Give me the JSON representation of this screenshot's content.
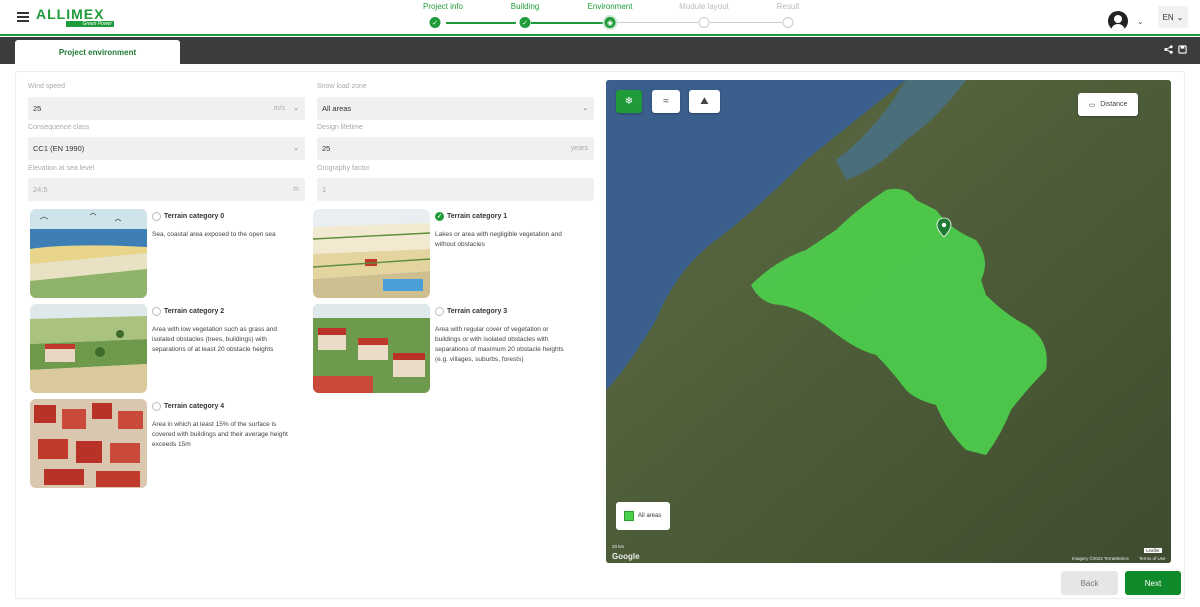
{
  "brand": {
    "name": "ALLIMEX",
    "tagline": "Green Power"
  },
  "language": "EN",
  "steps": [
    {
      "label": "Project info",
      "state": "done"
    },
    {
      "label": "Building",
      "state": "done"
    },
    {
      "label": "Environment",
      "state": "current"
    },
    {
      "label": "Module layout",
      "state": "todo"
    },
    {
      "label": "Result",
      "state": "todo"
    }
  ],
  "tab": {
    "label": "Project environment"
  },
  "fields": {
    "wind_speed": {
      "label": "Wind speed",
      "value": "25",
      "unit": "m/s"
    },
    "snow_load_zone": {
      "label": "Snow load zone",
      "value": "All areas"
    },
    "consequence_class": {
      "label": "Consequence class",
      "value": "CC1 (EN 1990)"
    },
    "design_lifetime": {
      "label": "Design lifetime",
      "value": "25",
      "unit": "years"
    },
    "elevation": {
      "label": "Elevation at sea level",
      "value": "24.5",
      "unit": "m"
    },
    "orography": {
      "label": "Orography factor",
      "value": "1"
    }
  },
  "terrain": [
    {
      "title": "Terrain category 0",
      "desc": "Sea, coastal area exposed to the open sea",
      "checked": false
    },
    {
      "title": "Terrain category 1",
      "desc": "Lakes or area with negligible vegetation and without obstacles",
      "checked": true
    },
    {
      "title": "Terrain category 2",
      "desc": "Area with low vegetation such as grass and isolated obstacles (trees, buildings) with separations of at least 20 obstacle heights",
      "checked": false
    },
    {
      "title": "Terrain category 3",
      "desc": "Area with regular cover of vegetation or buildings or with isolated obstacles with separations of maximum 20 obstacle heights (e.g. villages, suburbs, forests)",
      "checked": false
    },
    {
      "title": "Terrain category 4",
      "desc": "Area in which at least 15% of the surface is covered with buildings and their average height exceeds 15m",
      "checked": false
    }
  ],
  "map": {
    "distance_label": "Distance",
    "legend_label": "All areas",
    "legend_color": "#4cd14c",
    "scale": "20 km",
    "google": "Google",
    "leaflet": "Leaflet",
    "imagery": "Imagery ©2022 TerraMetrics",
    "terms": "Terms of Use"
  },
  "buttons": {
    "back": "Back",
    "next": "Next"
  },
  "colors": {
    "primary": "#1f9b3a",
    "dark_band": "#3b3c3e"
  }
}
